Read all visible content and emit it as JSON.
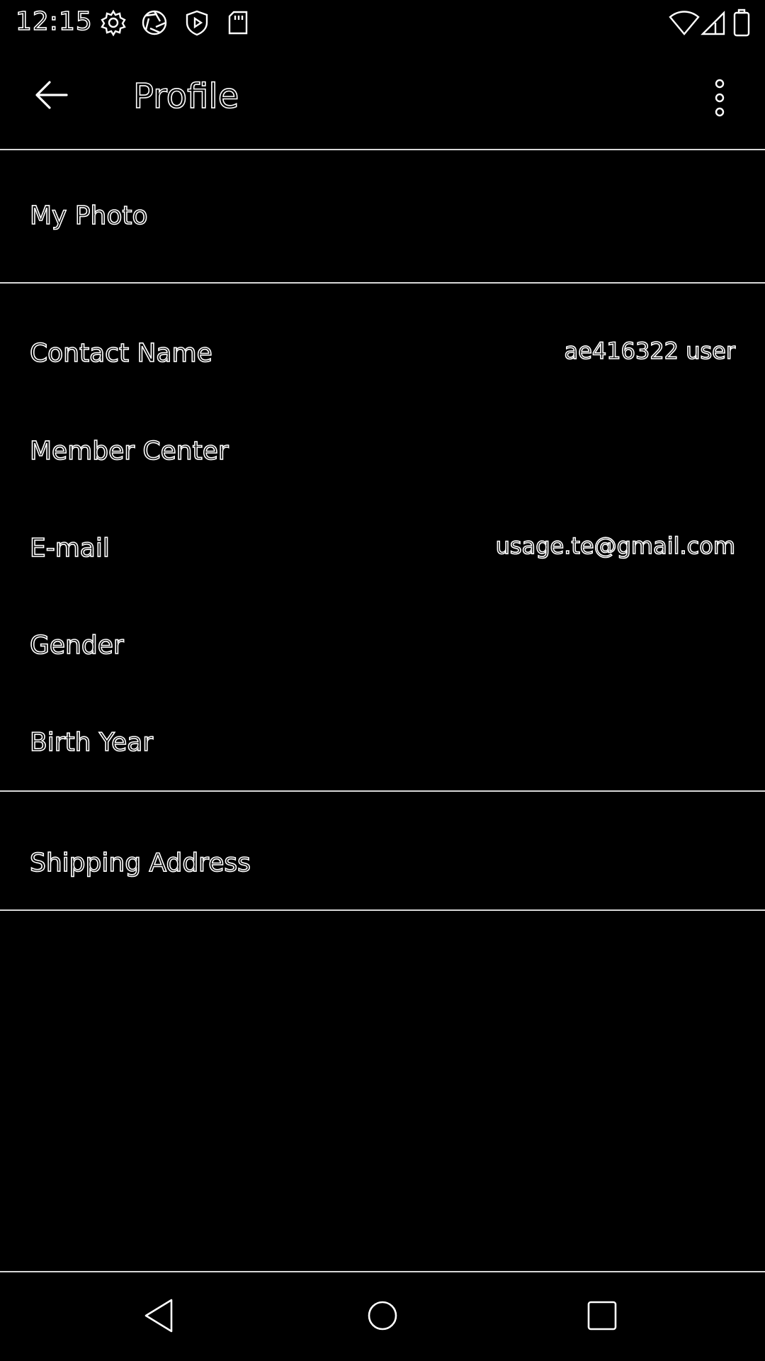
{
  "status_bar": {
    "time": "12:15",
    "left_icons": [
      "gear-icon",
      "aperture-icon",
      "shield-play-icon",
      "sd-card-icon"
    ],
    "right_icons": [
      "wifi-icon",
      "cell-signal-icon",
      "battery-icon"
    ]
  },
  "app_bar": {
    "title": "Profile",
    "back_icon": "arrow-back-icon",
    "menu_icon": "more-vert-icon"
  },
  "sections": {
    "photo": {
      "label": "My Photo"
    },
    "contact_name": {
      "label": "Contact Name",
      "value": "ae416322 user"
    },
    "member_center": {
      "label": "Member Center"
    },
    "email": {
      "label": "E-mail",
      "value": "usage.te@gmail.com"
    },
    "gender": {
      "label": "Gender"
    },
    "birth_year": {
      "label": "Birth Year"
    },
    "shipping_address": {
      "label": "Shipping Address"
    }
  },
  "nav_bar": {
    "icons": [
      "nav-back-triangle-icon",
      "nav-home-circle-icon",
      "nav-recents-square-icon"
    ]
  },
  "colors": {
    "background": "#000000",
    "outline": "#ffffff",
    "divider": "#d8d8d8"
  }
}
